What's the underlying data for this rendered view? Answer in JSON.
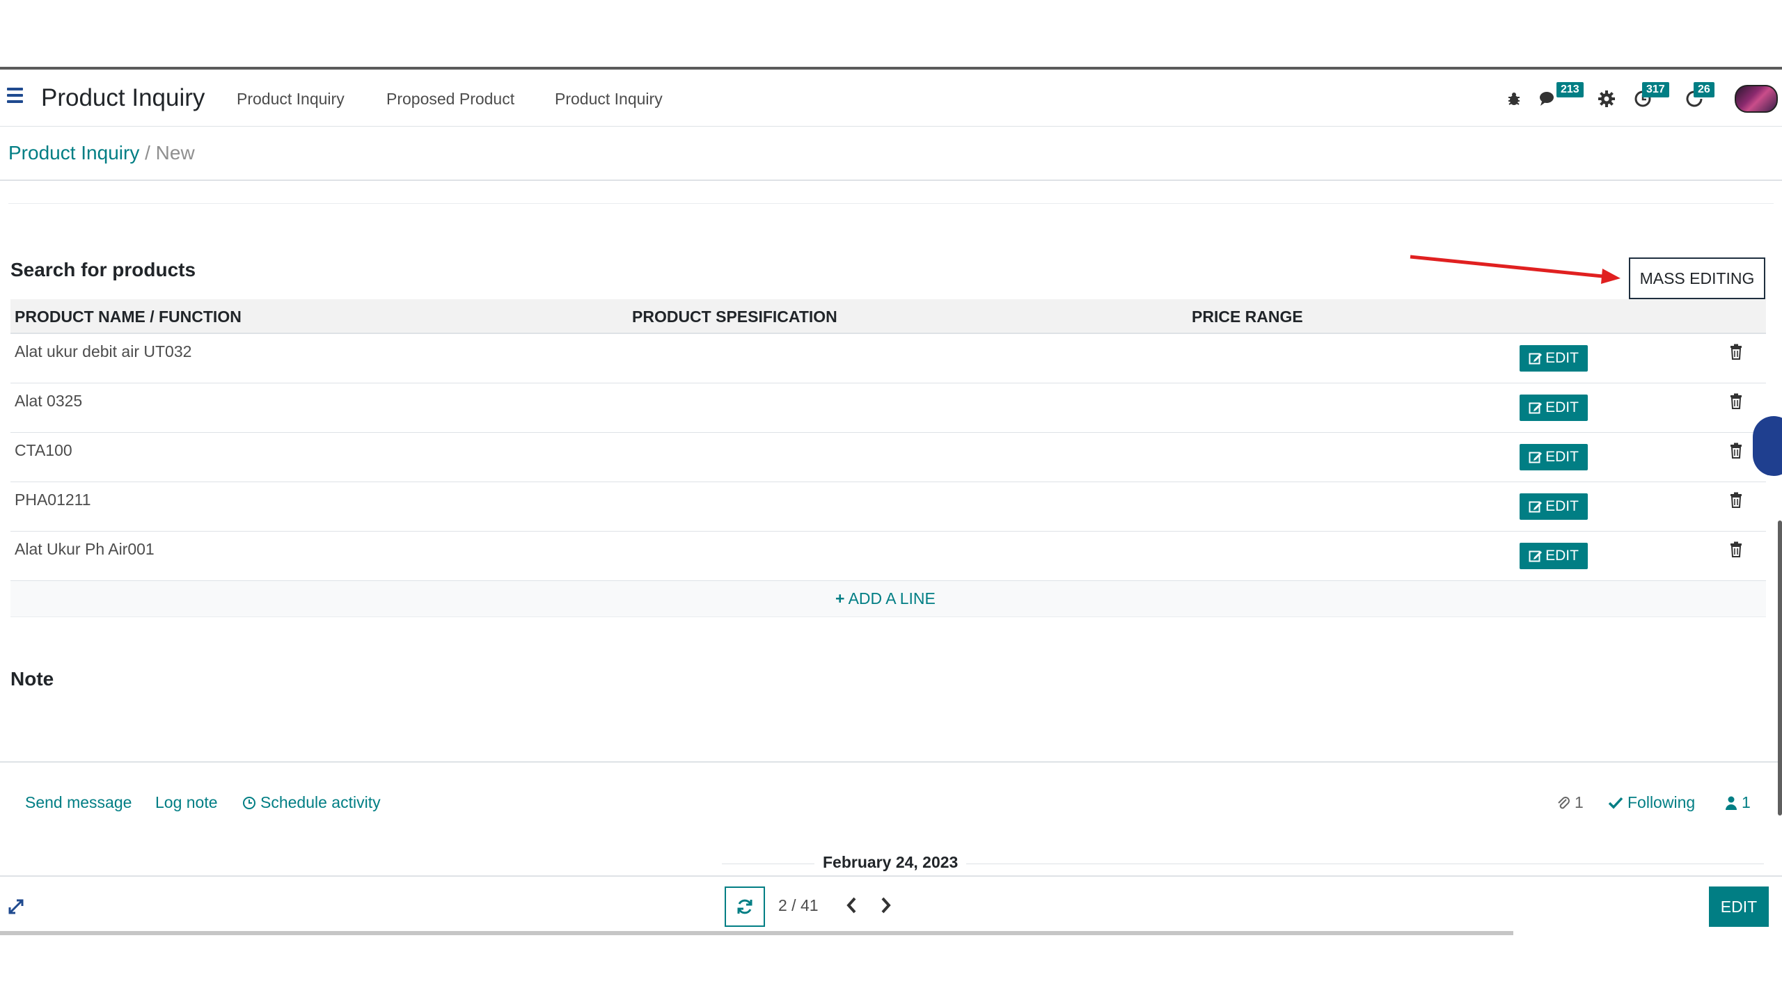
{
  "navbar": {
    "app_title": "Product Inquiry",
    "menu": [
      "Product Inquiry",
      "Proposed Product",
      "Product Inquiry"
    ],
    "badges": {
      "messages": "213",
      "activities": "317",
      "timers": "26"
    }
  },
  "breadcrumb": {
    "parent": "Product Inquiry",
    "separator": "/",
    "current": "New"
  },
  "products": {
    "title": "Search for products",
    "mass_editing": "MASS EDITING",
    "columns": [
      "PRODUCT NAME / FUNCTION",
      "PRODUCT SPESIFICATION",
      "PRICE RANGE"
    ],
    "rows": [
      {
        "name": "Alat ukur debit air UT032",
        "spec": "",
        "price": ""
      },
      {
        "name": "Alat 0325",
        "spec": "",
        "price": ""
      },
      {
        "name": "CTA100",
        "spec": "",
        "price": ""
      },
      {
        "name": "PHA01211",
        "spec": "",
        "price": ""
      },
      {
        "name": "Alat Ukur Ph Air001",
        "spec": "",
        "price": ""
      }
    ],
    "edit_label": "EDIT",
    "add_line": "ADD A LINE"
  },
  "note": {
    "title": "Note"
  },
  "chatter": {
    "send_message": "Send message",
    "log_note": "Log note",
    "schedule_activity": "Schedule activity",
    "attachments": "1",
    "following": "Following",
    "followers": "1",
    "date": "February 24, 2023"
  },
  "pager": {
    "value": "2 / 41"
  },
  "footer": {
    "edit_label": "EDIT"
  },
  "colors": {
    "accent": "#017e84",
    "annotation_arrow": "#e02020"
  }
}
